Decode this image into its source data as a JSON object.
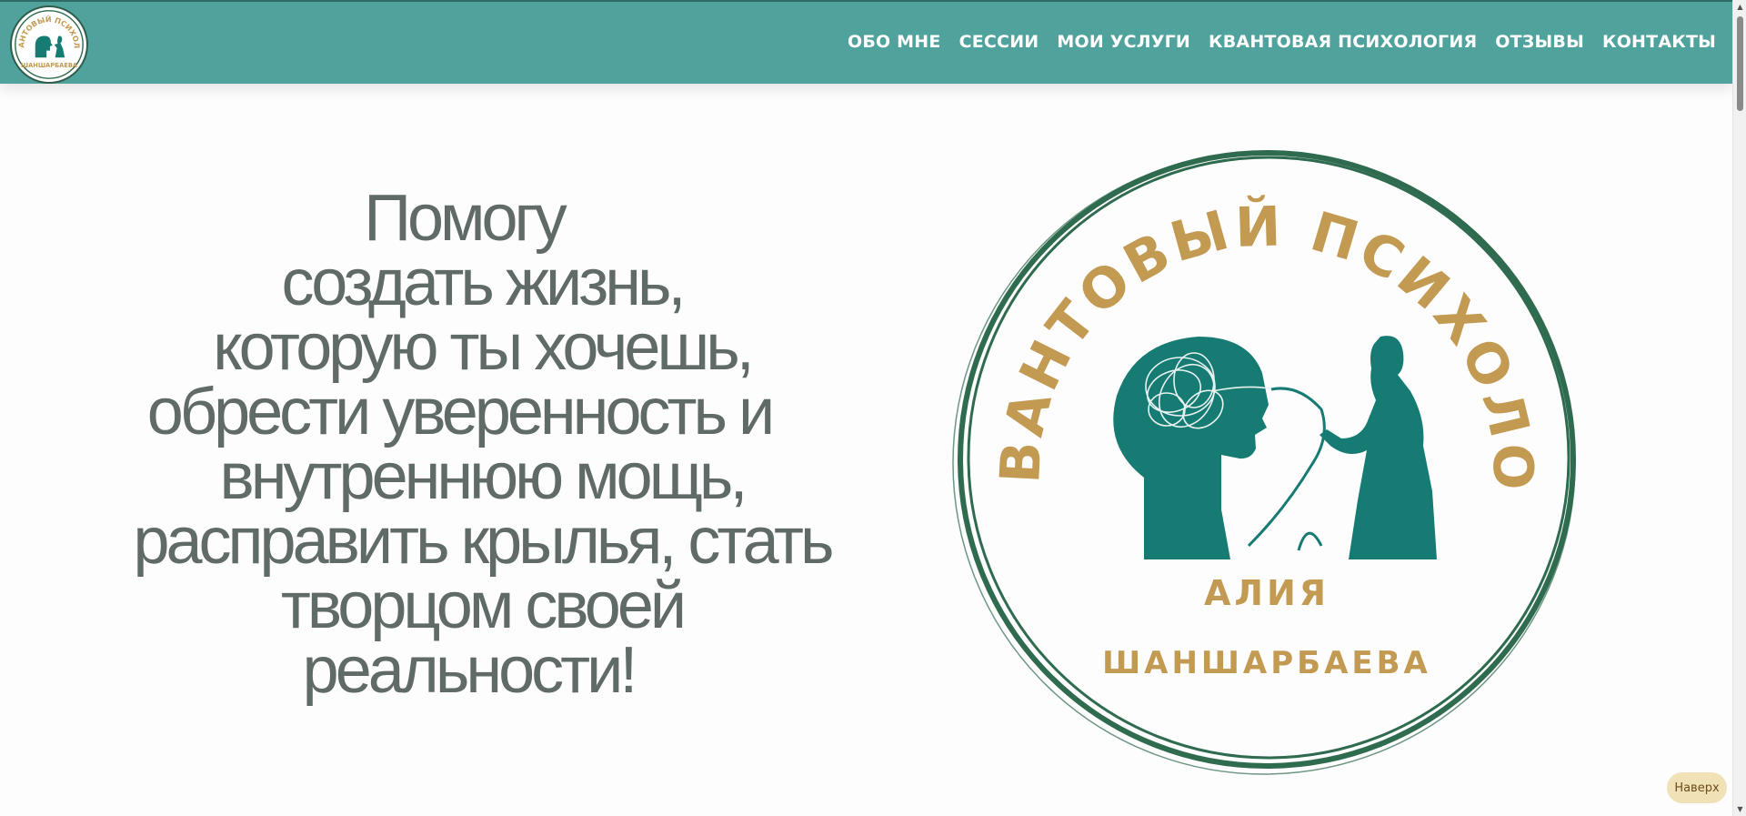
{
  "header": {
    "logo": {
      "top_text": "КВАНТОВЫЙ ПСИХОЛОГ",
      "bottom_text": "ШАНШАРБАЕВА"
    },
    "nav": [
      {
        "label": "ОБО МНЕ"
      },
      {
        "label": "СЕССИИ"
      },
      {
        "label": "МОИ УСЛУГИ"
      },
      {
        "label": "КВАНТОВАЯ ПСИХОЛОГИЯ"
      },
      {
        "label": "ОТЗЫВЫ"
      },
      {
        "label": "КОНТАКТЫ"
      }
    ]
  },
  "hero": {
    "lines": [
      "Помогу",
      "создать жизнь,",
      "которую ты хочешь,",
      "обрести уверенность и",
      "внутреннюю мощь,",
      "расправить крылья, стать",
      "творцом своей",
      "реальности!"
    ],
    "emblem": {
      "arc_text": "КВАНТОВЫЙ ПСИХОЛОГ",
      "first_name": "АЛИЯ",
      "last_name": "ШАНШАРБАЕВА"
    }
  },
  "to_top_label": "Наверх",
  "colors": {
    "header_bg": "#4fa39c",
    "text_gray": "#606a66",
    "emblem_gold": "#c39a52",
    "emblem_teal": "#167b73",
    "emblem_ring": "#2f6b4f",
    "to_top_bg": "#f0e2b6"
  }
}
